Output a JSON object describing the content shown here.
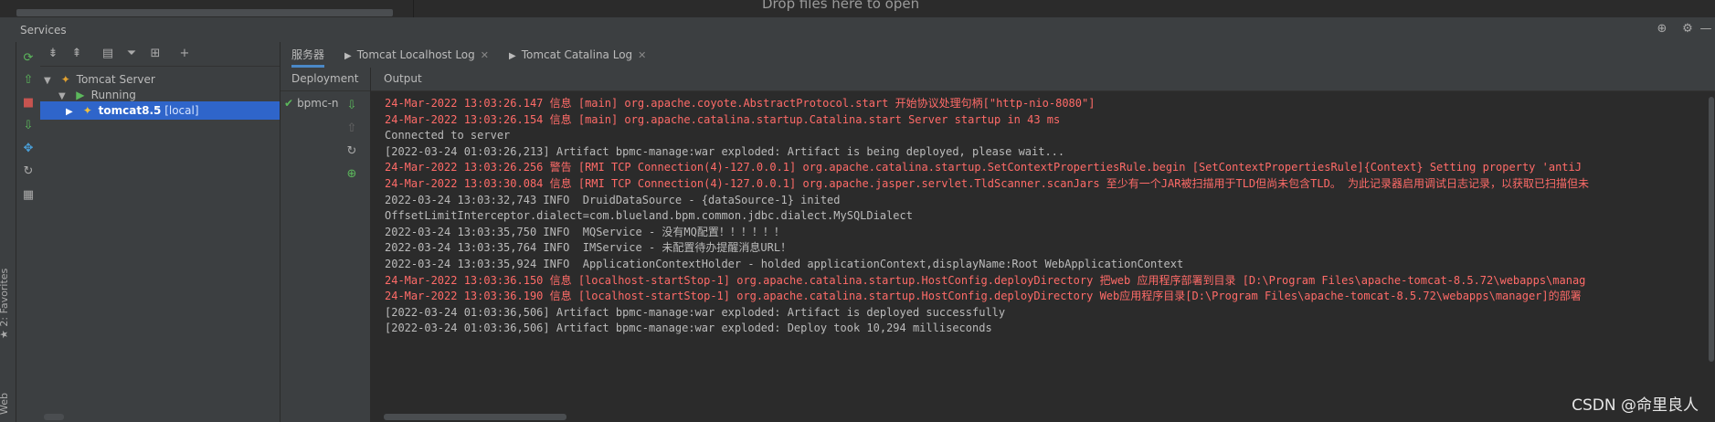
{
  "top": {
    "drop_text": "Drop files here to open"
  },
  "services_panel": {
    "title": "Services"
  },
  "left_strip": {
    "favorites_label": "2: Favorites",
    "web_label": "Web"
  },
  "tree": {
    "server": "Tomcat Server",
    "running": "Running",
    "instance_name": "tomcat8.5",
    "instance_suffix": "[local]"
  },
  "tabs": [
    {
      "label": "服务器"
    },
    {
      "label": "Tomcat Localhost Log"
    },
    {
      "label": "Tomcat Catalina Log"
    }
  ],
  "deployment": {
    "header": "Deployment",
    "item": "bpmc-n"
  },
  "output": {
    "header": "Output",
    "lines": [
      {
        "text": "24-Mar-2022 13:03:26.147 信息 [main] org.apache.coyote.AbstractProtocol.start 开始协议处理句柄[\"http-nio-8080\"]",
        "level": "err"
      },
      {
        "text": "24-Mar-2022 13:03:26.154 信息 [main] org.apache.catalina.startup.Catalina.start Server startup in 43 ms",
        "level": "err"
      },
      {
        "text": "Connected to server",
        "level": "norm"
      },
      {
        "text": "[2022-03-24 01:03:26,213] Artifact bpmc-manage:war exploded: Artifact is being deployed, please wait...",
        "level": "norm"
      },
      {
        "text": "24-Mar-2022 13:03:26.256 警告 [RMI TCP Connection(4)-127.0.0.1] org.apache.catalina.startup.SetContextPropertiesRule.begin [SetContextPropertiesRule]{Context} Setting property 'antiJ",
        "level": "err"
      },
      {
        "text": "24-Mar-2022 13:03:30.084 信息 [RMI TCP Connection(4)-127.0.0.1] org.apache.jasper.servlet.TldScanner.scanJars 至少有一个JAR被扫描用于TLD但尚未包含TLD。 为此记录器启用调试日志记录，以获取已扫描但未",
        "level": "err"
      },
      {
        "text": "2022-03-24 13:03:32,743 INFO  DruidDataSource - {dataSource-1} inited",
        "level": "norm"
      },
      {
        "text": "OffsetLimitInterceptor.dialect=com.blueland.bpm.common.jdbc.dialect.MySQLDialect",
        "level": "norm"
      },
      {
        "text": "2022-03-24 13:03:35,750 INFO  MQService - 没有MQ配置！！！！！！",
        "level": "norm"
      },
      {
        "text": "2022-03-24 13:03:35,764 INFO  IMService - 未配置待办提醒消息URL！",
        "level": "norm"
      },
      {
        "text": "2022-03-24 13:03:35,924 INFO  ApplicationContextHolder - holded applicationContext,displayName:Root WebApplicationContext",
        "level": "norm"
      },
      {
        "text": "24-Mar-2022 13:03:36.150 信息 [localhost-startStop-1] org.apache.catalina.startup.HostConfig.deployDirectory 把web 应用程序部署到目录 [D:\\Program Files\\apache-tomcat-8.5.72\\webapps\\manag",
        "level": "err"
      },
      {
        "text": "24-Mar-2022 13:03:36.190 信息 [localhost-startStop-1] org.apache.catalina.startup.HostConfig.deployDirectory Web应用程序目录[D:\\Program Files\\apache-tomcat-8.5.72\\webapps\\manager]的部署",
        "level": "err"
      },
      {
        "text": "[2022-03-24 01:03:36,506] Artifact bpmc-manage:war exploded: Artifact is deployed successfully",
        "level": "norm"
      },
      {
        "text": "[2022-03-24 01:03:36,506] Artifact bpmc-manage:war exploded: Deploy took 10,294 milliseconds",
        "level": "norm"
      }
    ]
  },
  "watermark": "CSDN @命里良人",
  "colors": {
    "error": "#ff6b68",
    "normal": "#bbbbbb",
    "selection": "#2f65ca",
    "run_green": "#5cb85c",
    "stop_red": "#c75450"
  }
}
